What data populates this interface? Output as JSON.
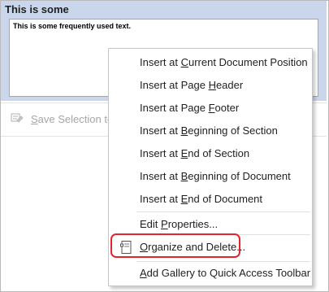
{
  "gallery": {
    "title": "This is some",
    "preview_text": "This is some frequently used text."
  },
  "bottom_bar": {
    "save_label": "Save Selection to A"
  },
  "menu": {
    "items": [
      {
        "pre": "Insert at ",
        "u": "C",
        "post": "urrent Document Position"
      },
      {
        "pre": "Insert at Page ",
        "u": "H",
        "post": "eader"
      },
      {
        "pre": "Insert at Page ",
        "u": "F",
        "post": "ooter"
      },
      {
        "pre": "Insert at ",
        "u": "B",
        "post": "eginning of Section"
      },
      {
        "pre": "Insert at ",
        "u": "E",
        "post": "nd of Section"
      },
      {
        "pre": "Insert at ",
        "u": "B",
        "post": "eginning of Document"
      },
      {
        "pre": "Insert at ",
        "u": "E",
        "post": "nd of Document"
      },
      {
        "pre": "Edit ",
        "u": "P",
        "post": "roperties..."
      },
      {
        "pre": "",
        "u": "O",
        "post": "rganize and Delete..."
      },
      {
        "pre": "",
        "u": "A",
        "post": "dd Gallery to Quick Access Toolbar"
      }
    ]
  },
  "colors": {
    "gallery_bg": "#c9d6ec",
    "highlight_border": "#e0262f"
  }
}
